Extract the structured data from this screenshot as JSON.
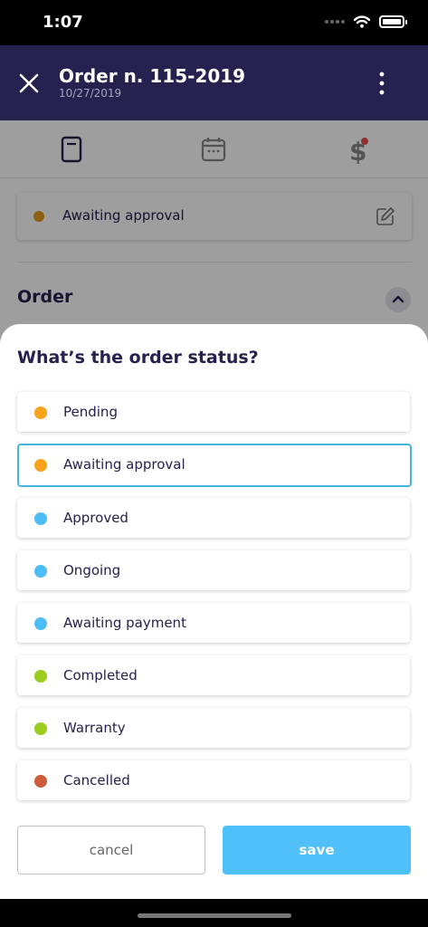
{
  "status_bar": {
    "time": "1:07"
  },
  "header": {
    "title": "Order n. 115-2019",
    "date": "10/27/2019"
  },
  "tabs": [
    {
      "icon": "document-icon"
    },
    {
      "icon": "calendar-icon"
    },
    {
      "icon": "dollar-icon",
      "badge": true
    }
  ],
  "current_status": {
    "label": "Awaiting approval",
    "color": "#e39a1d"
  },
  "section": {
    "title": "Order"
  },
  "sheet": {
    "title": "What’s the order status?",
    "options": [
      {
        "label": "Pending",
        "color": "#f7a31c",
        "selected": false
      },
      {
        "label": "Awaiting approval",
        "color": "#f7a31c",
        "selected": true
      },
      {
        "label": "Approved",
        "color": "#4dbdf5",
        "selected": false
      },
      {
        "label": "Ongoing",
        "color": "#4dbdf5",
        "selected": false
      },
      {
        "label": "Awaiting payment",
        "color": "#4dbdf5",
        "selected": false
      },
      {
        "label": "Completed",
        "color": "#9acd1d",
        "selected": false
      },
      {
        "label": "Warranty",
        "color": "#9acd1d",
        "selected": false
      },
      {
        "label": "Cancelled",
        "color": "#cd5b3c",
        "selected": false
      }
    ],
    "cancel_label": "cancel",
    "save_label": "save"
  },
  "colors": {
    "header_bg": "#26214f",
    "accent": "#4fc0f8",
    "selected_border": "#47b4de"
  }
}
